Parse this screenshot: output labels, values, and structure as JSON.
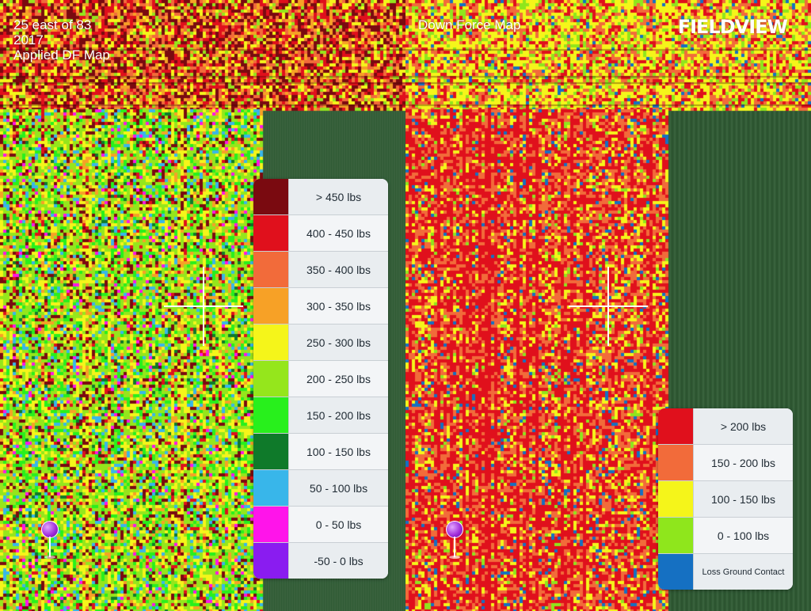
{
  "left_panel": {
    "title_lines": [
      "25 east of 83",
      "2017",
      "Applied DF Map"
    ],
    "legend": [
      {
        "label": "> 450 lbs",
        "color": "#7a0a10"
      },
      {
        "label": "400 - 450 lbs",
        "color": "#e0101c"
      },
      {
        "label": "350 - 400 lbs",
        "color": "#f26b3a"
      },
      {
        "label": "300 - 350 lbs",
        "color": "#f7a126"
      },
      {
        "label": "250 - 300 lbs",
        "color": "#f5f51a"
      },
      {
        "label": "200 - 250 lbs",
        "color": "#95e61c"
      },
      {
        "label": "150 - 200 lbs",
        "color": "#28f01c"
      },
      {
        "label": "100 - 150 lbs",
        "color": "#0f7a2a"
      },
      {
        "label": "50 - 100 lbs",
        "color": "#38b6ea"
      },
      {
        "label": "0 - 50 lbs",
        "color": "#ff14ea"
      },
      {
        "label": "-50 - 0 lbs",
        "color": "#8a1cf0"
      }
    ]
  },
  "right_panel": {
    "title": "Down Force Map",
    "logo": "FIELDVIEW",
    "legend": [
      {
        "label": "> 200 lbs",
        "color": "#e0101c"
      },
      {
        "label": "150 - 200 lbs",
        "color": "#f26b3a"
      },
      {
        "label": "100 - 150 lbs",
        "color": "#f5f51a"
      },
      {
        "label": "0 - 100 lbs",
        "color": "#8fe61c"
      },
      {
        "label": "Loss Ground Contact",
        "color": "#1570c2"
      }
    ]
  },
  "colors": {
    "field_background": "#2f5a34",
    "crosshair": "#ffffff",
    "pin": "#9c27d9"
  }
}
